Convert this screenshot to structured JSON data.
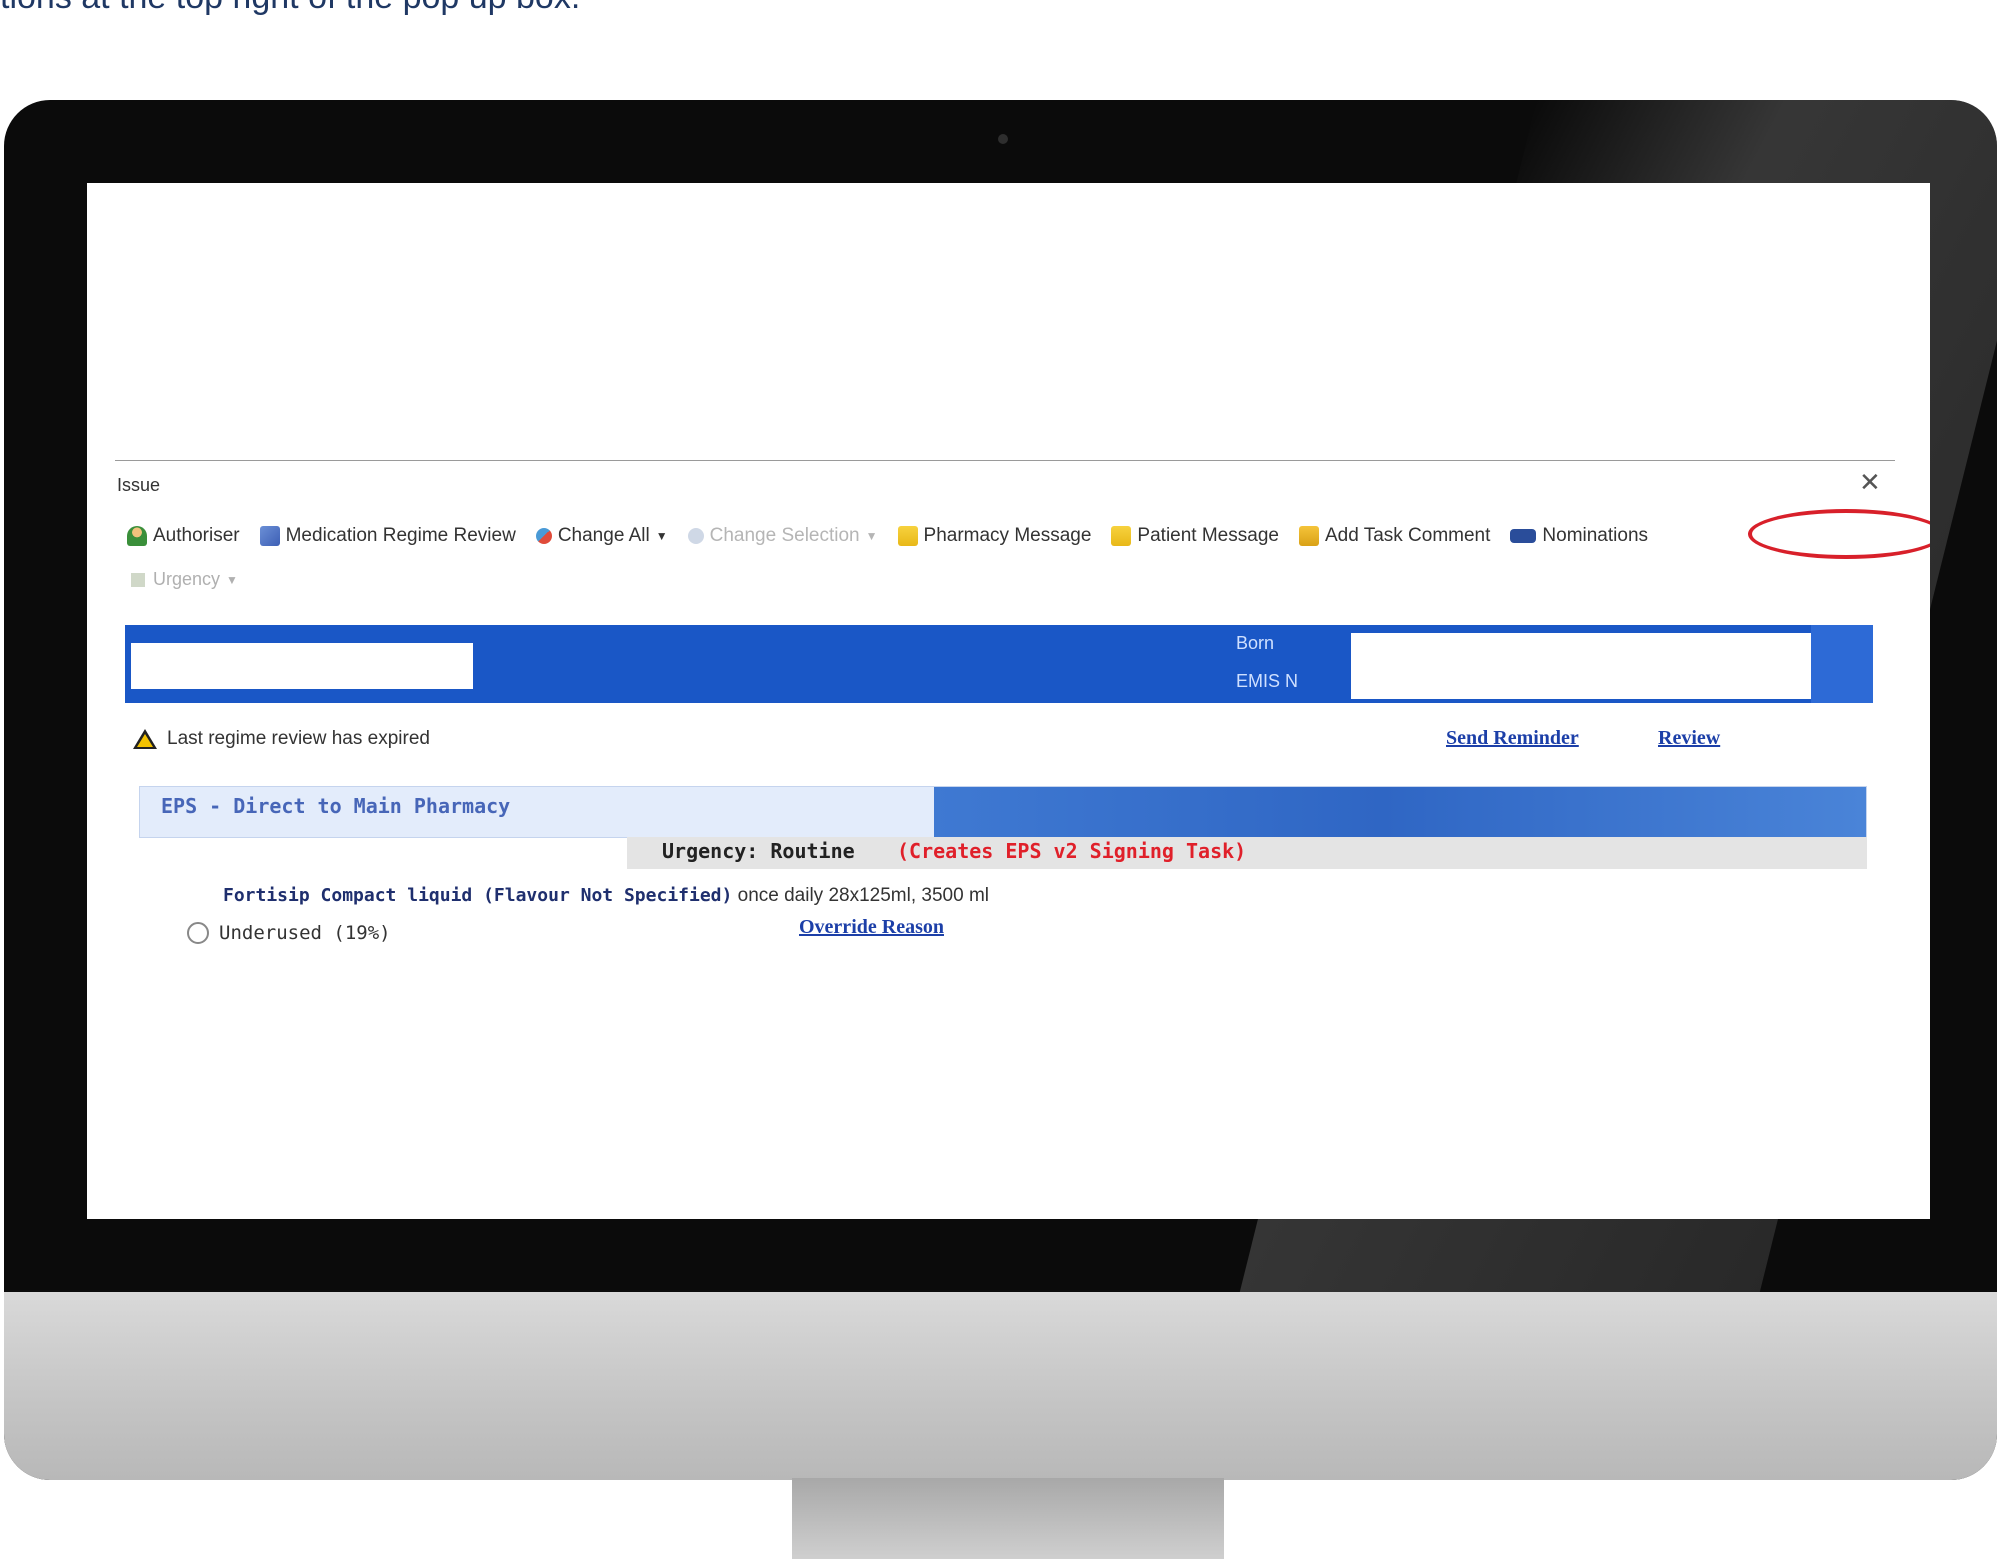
{
  "caption": "tions at the top right of the pop up box.",
  "dialog": {
    "title": "Issue",
    "close": "✕"
  },
  "toolbar": {
    "items": [
      {
        "label": "Authoriser",
        "icon": "person-icon"
      },
      {
        "label": "Medication Regime Review",
        "icon": "review-icon"
      },
      {
        "label": "Change All",
        "icon": "change-icon"
      },
      {
        "label": "Change Selection",
        "icon": "change-disabled-icon"
      },
      {
        "label": "Pharmacy Message",
        "icon": "note-icon"
      },
      {
        "label": "Patient Message",
        "icon": "note-icon"
      },
      {
        "label": "Add Task Comment",
        "icon": "task-icon"
      },
      {
        "label": "Nominations",
        "icon": "eps-icon"
      }
    ],
    "urgency": "Urgency"
  },
  "banner": {
    "born_label": "Born",
    "emis_label": "EMIS N"
  },
  "warning": {
    "text": "Last regime review has expired",
    "send_reminder": "Send Reminder",
    "review": "Review"
  },
  "eps": {
    "title": "EPS - Direct to Main Pharmacy",
    "urgency": "Urgency: Routine",
    "task": "(Creates EPS v2 Signing Task)"
  },
  "drug": {
    "name": "Fortisip Compact liquid (Flavour Not Specified)",
    "dose": " once daily 28x125ml, 3500 ml",
    "usage": "Underused (19%)",
    "override": "Override Reason"
  },
  "colors": {
    "banner": "#1a57c6",
    "highlight_ring": "#d8202a",
    "task_red": "#e0202a",
    "link_blue": "#1c3fa8"
  }
}
